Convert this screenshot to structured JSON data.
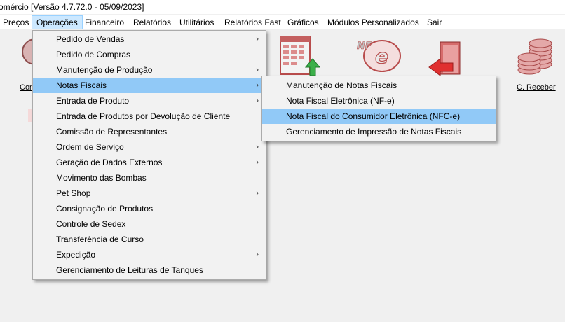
{
  "window": {
    "title": "omércio [Versão 4.7.72.0 - 05/09/2023]"
  },
  "menubar": {
    "items": [
      "Preços",
      "Operações",
      "Financeiro",
      "Relatórios",
      "Utilitários",
      "Relatórios Fast",
      "Gráficos",
      "Módulos Personalizados",
      "Sair"
    ],
    "active": "Operações"
  },
  "toolbar": {
    "left_label": "Con",
    "right_label": "C. Receber",
    "icons": [
      "report-icon",
      "nfe-icon",
      "document-icon",
      "coins-icon"
    ]
  },
  "operacoes_menu": {
    "items": [
      {
        "label": "Pedido de Vendas",
        "submenu": true
      },
      {
        "label": "Pedido de Compras",
        "submenu": false
      },
      {
        "label": "Manutenção de Produção",
        "submenu": true
      },
      {
        "label": "Notas Fiscais",
        "submenu": true
      },
      {
        "label": "Entrada de Produto",
        "submenu": true
      },
      {
        "label": "Entrada de Produtos por Devolução de Cliente",
        "submenu": false
      },
      {
        "label": "Comissão de Representantes",
        "submenu": false
      },
      {
        "label": "Ordem de Serviço",
        "submenu": true
      },
      {
        "label": "Geração de Dados Externos",
        "submenu": true
      },
      {
        "label": "Movimento das Bombas",
        "submenu": false
      },
      {
        "label": "Pet Shop",
        "submenu": true
      },
      {
        "label": "Consignação de Produtos",
        "submenu": false
      },
      {
        "label": "Controle de Sedex",
        "submenu": false
      },
      {
        "label": "Transferência de Curso",
        "submenu": false
      },
      {
        "label": "Expedição",
        "submenu": true
      },
      {
        "label": "Gerenciamento de Leituras de Tanques",
        "submenu": false
      }
    ],
    "highlighted": "Notas Fiscais"
  },
  "notas_fiscais_submenu": {
    "items": [
      "Manutenção de Notas Fiscais",
      "Nota Fiscal Eletrônica (NF-e)",
      "Nota Fiscal do Consumidor Eletrônica (NFC-e)",
      "Gerenciamento de Impressão de Notas Fiscais"
    ],
    "highlighted": "Nota Fiscal do Consumidor Eletrônica (NFC-e)"
  },
  "arrow_glyph": "›"
}
